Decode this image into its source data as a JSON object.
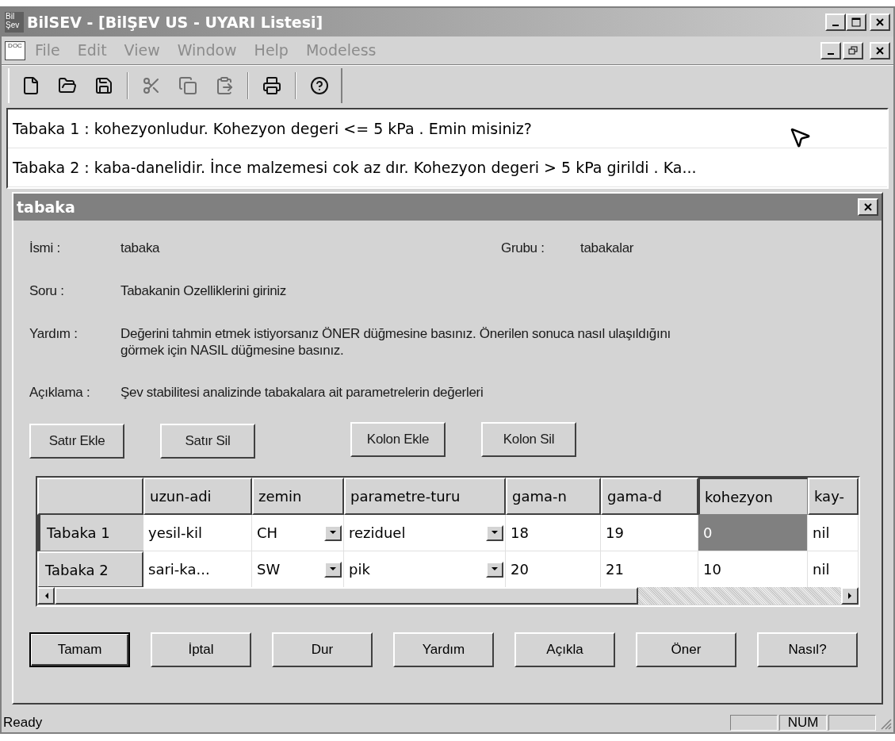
{
  "window": {
    "title": "BilSEV - [BilŞEV US - UYARI Listesi]",
    "logo_lines": [
      "Bil",
      "Şev"
    ]
  },
  "menu": {
    "doc_icon_text": "DOC",
    "items": [
      {
        "label": "File",
        "disabled": true
      },
      {
        "label": "Edit",
        "disabled": true
      },
      {
        "label": "View",
        "disabled": true
      },
      {
        "label": "Window",
        "disabled": true
      },
      {
        "label": "Help",
        "disabled": true
      },
      {
        "label": "Modeless",
        "disabled": true
      }
    ]
  },
  "warnings": [
    "Tabaka 1 : kohezyonludur.  Kohezyon degeri <= 5 kPa . Emin misiniz?",
    "Tabaka 2 : kaba-danelidir. İnce malzemesi cok az dır.  Kohezyon degeri > 5 kPa girildi . Ka..."
  ],
  "dialog": {
    "title": "tabaka",
    "fields": [
      {
        "label": "İsmi :",
        "value": "tabaka",
        "extra_label": "Grubu :",
        "extra_value": "tabakalar"
      },
      {
        "label": "Soru :",
        "value": "Tabakanin Ozelliklerini giriniz"
      },
      {
        "label": "Yardım :",
        "value": "Değerini tahmin etmek istiyorsanız ÖNER düğmesine basınız. Önerilen sonuca nasıl ulaşıldığını görmek için NASIL düğmesine basınız."
      },
      {
        "label": "Açıklama :",
        "value": "Şev stabilitesi analizinde tabakalara ait parametrelerin değerleri"
      }
    ],
    "edit_buttons": [
      "Satır Ekle",
      "Satır Sil",
      "Kolon Ekle",
      "Kolon Sil"
    ],
    "table": {
      "columns": [
        {
          "label": "uzun-adi",
          "kind": "text",
          "current": false
        },
        {
          "label": "zemin",
          "kind": "dropdown",
          "current": false
        },
        {
          "label": "parametre-turu",
          "kind": "dropdown",
          "current": false
        },
        {
          "label": "gama-n",
          "kind": "text",
          "current": false
        },
        {
          "label": "gama-d",
          "kind": "text",
          "current": false
        },
        {
          "label": "kohezyon",
          "kind": "text",
          "current": true
        },
        {
          "label": "kay-",
          "kind": "text",
          "current": false
        }
      ],
      "rows": [
        {
          "header": "Tabaka 1",
          "current": true,
          "cells": [
            {
              "text": "yesil-kil",
              "selected": false
            },
            {
              "text": "CH",
              "selected": false
            },
            {
              "text": "reziduel",
              "selected": false
            },
            {
              "text": "18",
              "selected": false
            },
            {
              "text": "19",
              "selected": false
            },
            {
              "text": "0",
              "selected": true
            },
            {
              "text": "nil",
              "selected": false
            }
          ]
        },
        {
          "header": "Tabaka 2",
          "current": false,
          "cells": [
            {
              "text": "sari-ka...",
              "selected": false
            },
            {
              "text": "SW",
              "selected": false
            },
            {
              "text": "pik",
              "selected": false
            },
            {
              "text": "20",
              "selected": false
            },
            {
              "text": "21",
              "selected": false
            },
            {
              "text": "10",
              "selected": false
            },
            {
              "text": "nil",
              "selected": false
            }
          ]
        }
      ]
    },
    "buttons": [
      {
        "label": "Tamam",
        "default": true
      },
      {
        "label": "İptal",
        "default": false
      },
      {
        "label": "Dur",
        "default": false
      },
      {
        "label": "Yardım",
        "default": false
      },
      {
        "label": "Açıkla",
        "default": false
      },
      {
        "label": "Öner",
        "default": false
      },
      {
        "label": "Nasıl?",
        "default": false
      }
    ]
  },
  "status_bar": {
    "text": "Ready",
    "num_indicator": "NUM"
  }
}
